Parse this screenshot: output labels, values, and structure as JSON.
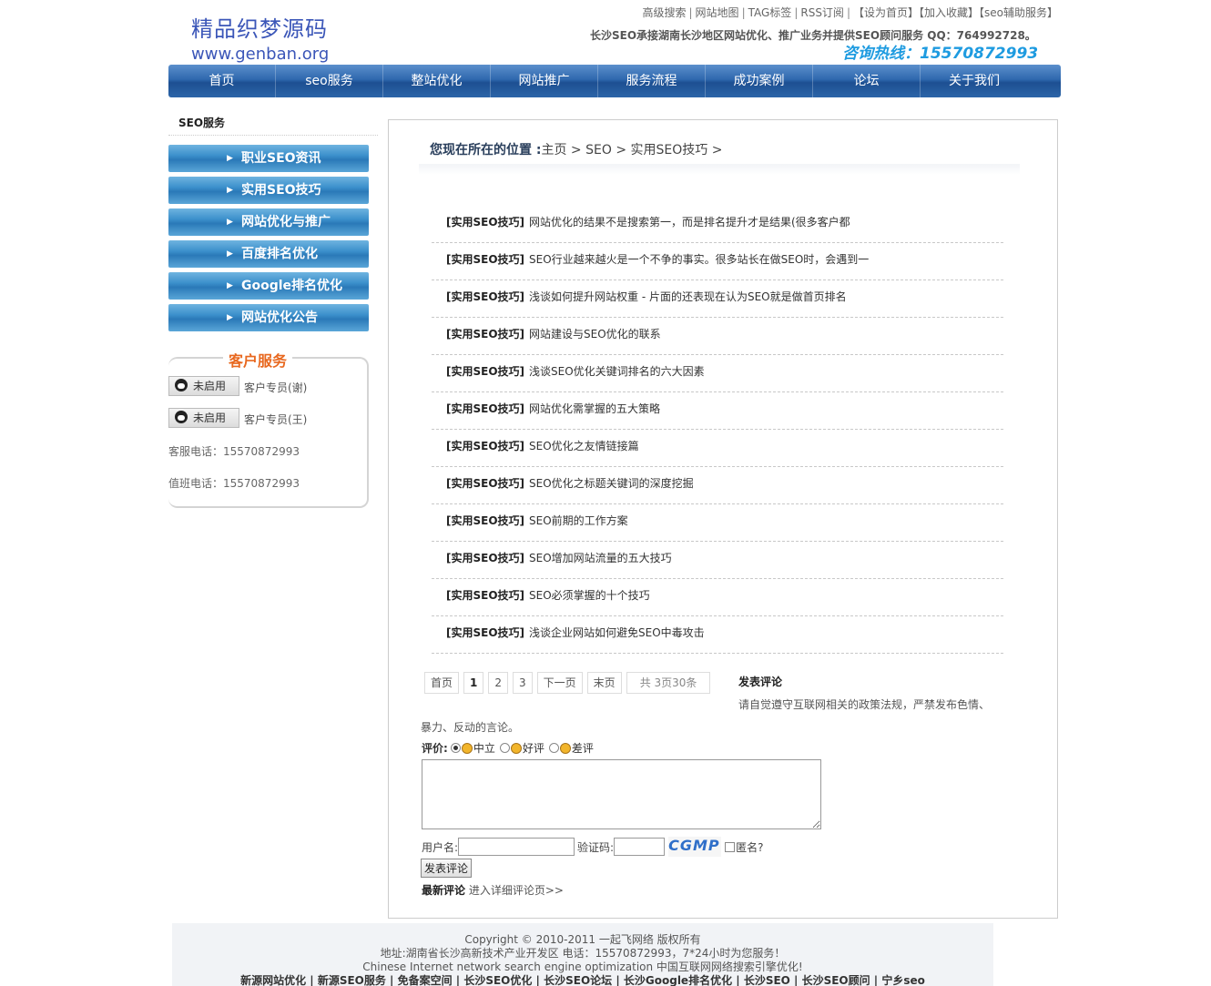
{
  "header": {
    "logo_cn": "精品织梦源码",
    "logo_en": "www.genban.org",
    "toplinks": [
      "高级搜索",
      "网站地图",
      "TAG标签",
      "RSS订阅",
      "【设为首页】",
      "【加入收藏】",
      "【seo辅助服务】"
    ],
    "tagline": "长沙SEO承接湖南长沙地区网站优化、推广业务并提供SEO顾问服务 QQ：764992728。",
    "hotline": "咨询热线：15570872993"
  },
  "nav": [
    "首页",
    "seo服务",
    "整站优化",
    "网站推广",
    "服务流程",
    "成功案例",
    "论坛",
    "关于我们"
  ],
  "sidebar": {
    "title": "SEO服务",
    "menu": [
      "职业SEO资讯",
      "实用SEO技巧",
      "网站优化与推广",
      "百度排名优化",
      "Google排名优化",
      "网站优化公告"
    ],
    "cs_title": "客户服务",
    "qq_status": "未启用",
    "agents": [
      "客户专员(谢)",
      "客户专员(王)"
    ],
    "phones": [
      "客服电话：15570872993",
      "值班电话：15570872993"
    ]
  },
  "breadcrumb": {
    "label": "您现在所在的位置 :",
    "path": "主页 > SEO > 实用SEO技巧 >"
  },
  "articles": [
    {
      "cat": "[实用SEO技巧]",
      "title": "网站优化的结果不是搜索第一，而是排名提升才是结果(很多客户都"
    },
    {
      "cat": "[实用SEO技巧]",
      "title": "SEO行业越来越火是一个不争的事实。很多站长在做SEO时，会遇到一"
    },
    {
      "cat": "[实用SEO技巧]",
      "title": "浅谈如何提升网站权重 - 片面的还表现在认为SEO就是做首页排名"
    },
    {
      "cat": "[实用SEO技巧]",
      "title": "网站建设与SEO优化的联系"
    },
    {
      "cat": "[实用SEO技巧]",
      "title": "浅谈SEO优化关键词排名的六大因素"
    },
    {
      "cat": "[实用SEO技巧]",
      "title": "网站优化需掌握的五大策略"
    },
    {
      "cat": "[实用SEO技巧]",
      "title": "SEO优化之友情链接篇"
    },
    {
      "cat": "[实用SEO技巧]",
      "title": "SEO优化之标题关键词的深度挖掘"
    },
    {
      "cat": "[实用SEO技巧]",
      "title": "SEO前期的工作方案"
    },
    {
      "cat": "[实用SEO技巧]",
      "title": "SEO增加网站流量的五大技巧"
    },
    {
      "cat": "[实用SEO技巧]",
      "title": "SEO必须掌握的十个技巧"
    },
    {
      "cat": "[实用SEO技巧]",
      "title": "浅谈企业网站如何避免SEO中毒攻击"
    }
  ],
  "pager": {
    "first": "首页",
    "p1": "1",
    "p2": "2",
    "p3": "3",
    "next": "下一页",
    "last": "末页",
    "info": "共 3页30条"
  },
  "comment": {
    "title": "发表评论",
    "rule1": "请自觉遵守互联网相关的政策法规，严禁发布色情、",
    "rule2": "暴力、反动的言论。",
    "rating_label": "评价:",
    "opt_neutral": "中立",
    "opt_good": "好评",
    "opt_bad": "差评",
    "username_label": "用户名:",
    "captcha_label": "验证码:",
    "captcha_text": "CGMP",
    "anon_label": "匿名?",
    "submit": "发表评论",
    "latest_label": "最新评论",
    "latest_link": "进入详细评论页>>"
  },
  "footer": {
    "copyright": "Copyright © 2010-2011 一起飞网络 版权所有",
    "address": "地址:湖南省长沙高新技术产业开发区 电话：15570872993，7*24小时为您服务！",
    "english": "Chinese Internet network search engine optimization 中国互联网网络搜索引擎优化!",
    "links": "新源网站优化 | 新源SEO服务 | 免备案空间 | 长沙SEO优化 | 长沙SEO论坛 | 长沙Google排名优化 | 长沙SEO | 长沙SEO顾问 | 宁乡seo"
  }
}
